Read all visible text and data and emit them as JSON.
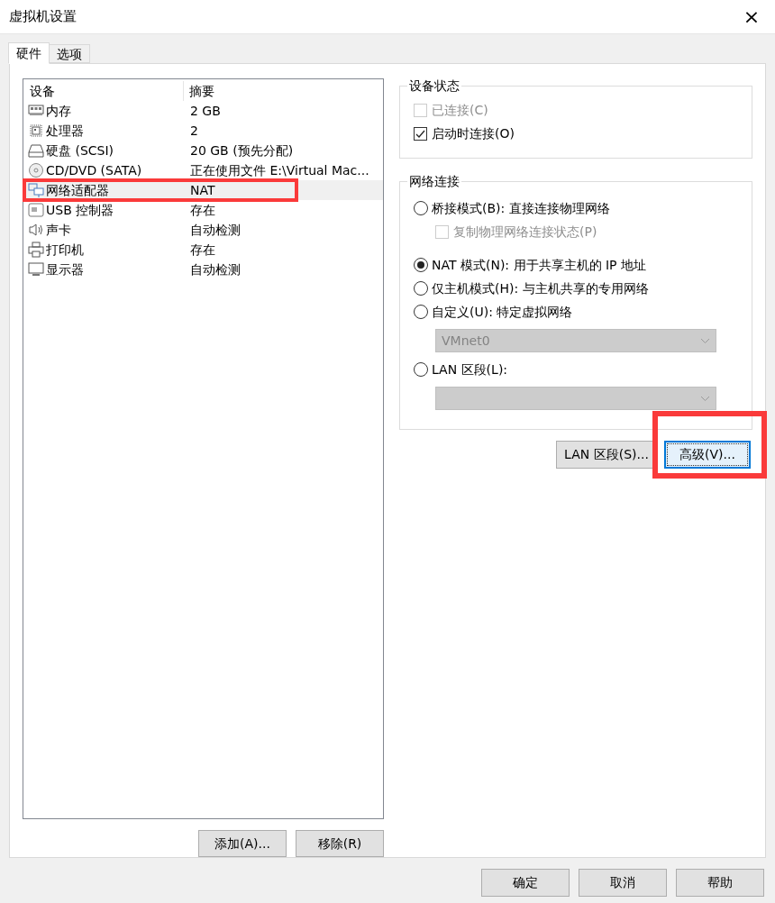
{
  "window": {
    "title": "虚拟机设置",
    "close": "×"
  },
  "tabs": [
    {
      "label": "硬件",
      "selected": true
    },
    {
      "label": "选项",
      "selected": false
    }
  ],
  "devices": {
    "columns": [
      "设备",
      "摘要"
    ],
    "rows": [
      {
        "name": "内存",
        "summary": "2 GB",
        "selected": false
      },
      {
        "name": "处理器",
        "summary": "2",
        "selected": false
      },
      {
        "name": "硬盘 (SCSI)",
        "summary": "20 GB (预先分配)",
        "selected": false
      },
      {
        "name": "CD/DVD (SATA)",
        "summary": "正在使用文件 E:\\Virtual Mac...",
        "selected": false
      },
      {
        "name": "网络适配器",
        "summary": "NAT",
        "selected": true
      },
      {
        "name": "USB 控制器",
        "summary": "存在",
        "selected": false
      },
      {
        "name": "声卡",
        "summary": "自动检测",
        "selected": false
      },
      {
        "name": "打印机",
        "summary": "存在",
        "selected": false
      },
      {
        "name": "显示器",
        "summary": "自动检测",
        "selected": false
      }
    ]
  },
  "device_buttons": [
    "添加(A)...",
    "移除(R)"
  ],
  "device_status": {
    "title": "设备状态",
    "options": [
      {
        "label": "已连接(C)",
        "checked": false,
        "disabled": true
      },
      {
        "label": "启动时连接(O)",
        "checked": true,
        "disabled": false
      }
    ]
  },
  "network": {
    "title": "网络连接",
    "items": [
      {
        "kind": "radio",
        "label": "桥接模式(B): 直接连接物理网络",
        "selected": false
      },
      {
        "kind": "checkbox",
        "label": "复制物理网络连接状态(P)",
        "checked": false,
        "disabled": true
      },
      {
        "kind": "radio",
        "label": "NAT 模式(N): 用于共享主机的 IP 地址",
        "selected": true
      },
      {
        "kind": "radio",
        "label": "仅主机模式(H): 与主机共享的专用网络",
        "selected": false
      },
      {
        "kind": "radio",
        "label": "自定义(U): 特定虚拟网络",
        "selected": false
      },
      {
        "kind": "select",
        "value": "VMnet0",
        "disabled": true
      },
      {
        "kind": "radio",
        "label": "LAN 区段(L):",
        "selected": false
      },
      {
        "kind": "select",
        "disabled": true
      }
    ]
  },
  "network_buttons": [
    {
      "label": "LAN 区段(S)...",
      "focused": false
    },
    {
      "label": "高级(V)...",
      "focused": true
    }
  ],
  "dialog_buttons": [
    "确定",
    "取消",
    "帮助"
  ],
  "annotations": [
    {
      "kind": "box"
    },
    {
      "kind": "box"
    }
  ]
}
